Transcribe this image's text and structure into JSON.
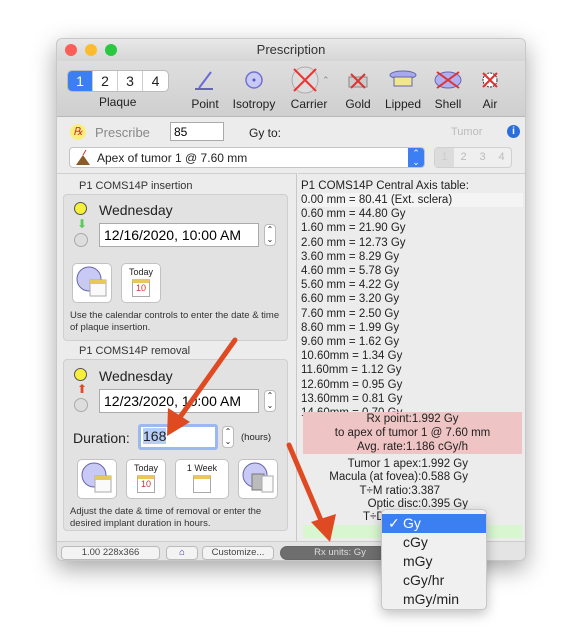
{
  "window": {
    "title": "Prescription"
  },
  "toolbar": {
    "plaque_tabs": [
      "1",
      "2",
      "3",
      "4"
    ],
    "plaque_selected": "1",
    "plaque_label": "Plaque",
    "tools": [
      {
        "label": "Point",
        "icon": "point-source-icon"
      },
      {
        "label": "Isotropy",
        "icon": "isotropy-icon"
      },
      {
        "label": "Carrier",
        "icon": "carrier-icon"
      },
      {
        "label": "Gold",
        "icon": "gold-icon"
      },
      {
        "label": "Lipped",
        "icon": "lipped-icon"
      },
      {
        "label": "Shell",
        "icon": "shell-icon"
      },
      {
        "label": "Air",
        "icon": "air-icon"
      }
    ]
  },
  "prescribe": {
    "label": "Prescribe",
    "value": "85",
    "gy_to": "Gy to:",
    "tumor_label": "Tumor",
    "target": "Apex of tumor 1 @ 7.60 mm",
    "tumor_tabs": [
      "1",
      "2",
      "3",
      "4"
    ]
  },
  "insertion": {
    "title": "P1 COMS14P insertion",
    "day": "Wednesday",
    "datetime": "12/16/2020, 10:00 AM",
    "today": "Today",
    "today_num": "10",
    "help": "Use the calendar controls to enter the date & time of plaque insertion."
  },
  "removal": {
    "title": "P1 COMS14P removal",
    "day": "Wednesday",
    "datetime": "12/23/2020, 10:00 AM",
    "duration_label": "Duration:",
    "duration": "168",
    "hours": "(hours)",
    "today": "Today",
    "today_num": "10",
    "week": "1 Week",
    "help": "Adjust the date & time of removal or enter the desired implant duration in hours."
  },
  "table": {
    "title": "P1 COMS14P Central Axis table:",
    "rows": [
      "0.00 mm = 80.41 (Ext. sclera)",
      "0.60 mm = 44.80 Gy",
      "1.60 mm = 21.90 Gy",
      "2.60 mm = 12.73 Gy",
      "3.60 mm = 8.29 Gy",
      "4.60 mm = 5.78 Gy",
      "5.60 mm = 4.22 Gy",
      "6.60 mm = 3.20 Gy",
      "7.60 mm = 2.50 Gy",
      "8.60 mm = 1.99 Gy",
      "9.60 mm = 1.62 Gy",
      "10.60mm = 1.34 Gy",
      "11.60mm = 1.12 Gy",
      "12.60mm = 0.95 Gy",
      "13.60mm = 0.81 Gy",
      "14.60mm = 0.70 Gy"
    ]
  },
  "rx_box": [
    "Rx point:1.992 Gy",
    "to apex of tumor 1 @ 7.60 mm",
    "Avg. rate:1.186 cGy/h"
  ],
  "summary": [
    "Tumor 1 apex:1.992 Gy",
    "Macula (at fovea):0.588 Gy",
    "T÷M ratio:3.387",
    "Optic disc:0.395 Gy",
    "T÷D"
  ],
  "bottom": {
    "zoom": "1.00 228x366",
    "customize": "Customize...",
    "rx_units": "Rx units: Gy"
  },
  "units_menu": {
    "items": [
      "Gy",
      "cGy",
      "mGy",
      "cGy/hr",
      "mGy/min"
    ],
    "selected": "Gy",
    "check": "✓"
  },
  "colors": {
    "accent": "#3b7ff3",
    "rx_box": "#eec4c4",
    "green_row": "#d8f7d0",
    "annotation_arrow": "#e04a22"
  }
}
